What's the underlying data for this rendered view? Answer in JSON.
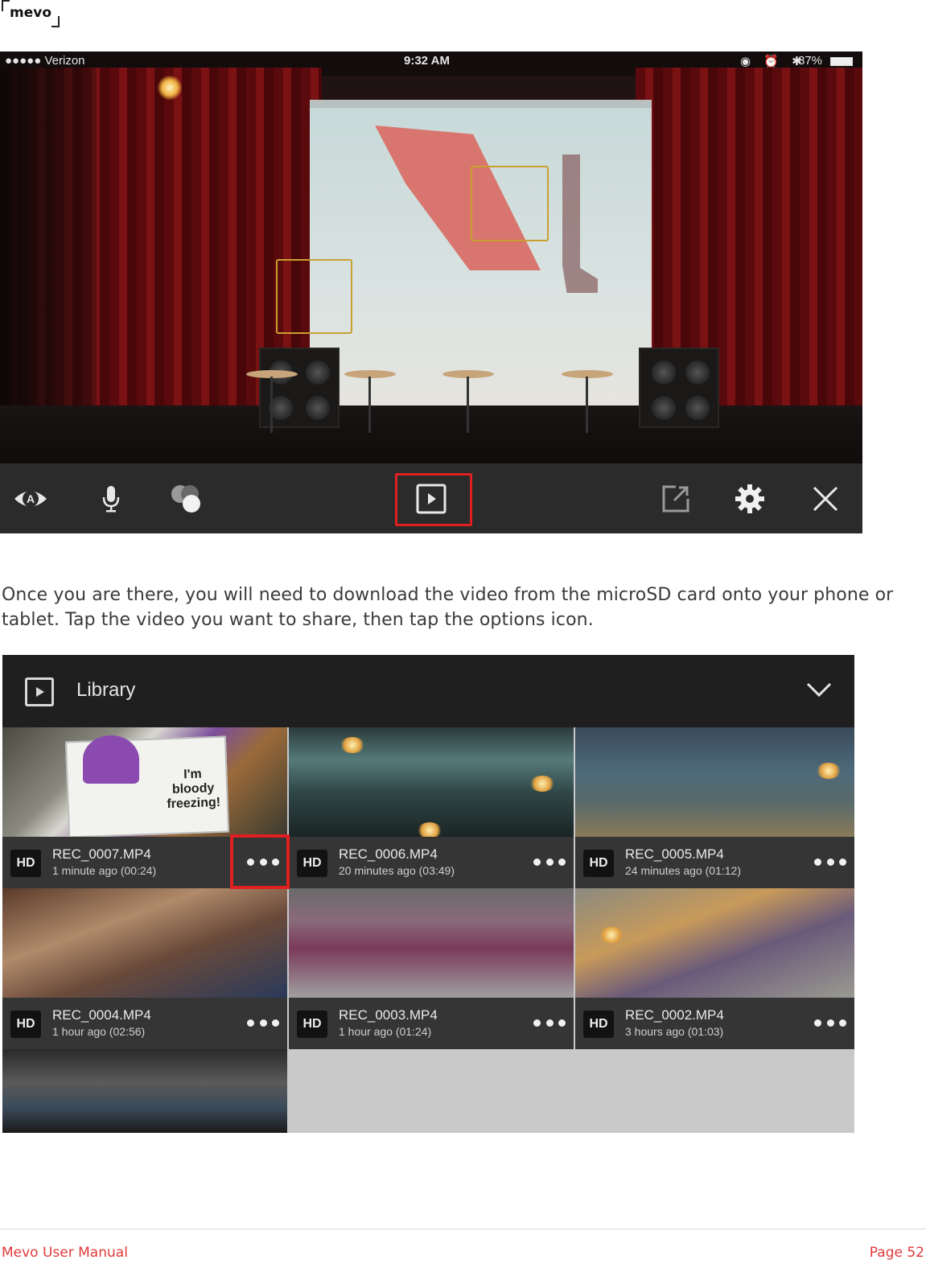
{
  "header": {
    "logo_text": "mevo"
  },
  "camera_view": {
    "status_bar": {
      "carrier": "●●●●● Verizon",
      "time": "9:32 AM",
      "battery": "87%"
    },
    "toolbar": {
      "items": [
        {
          "name": "auto-mode-icon"
        },
        {
          "name": "microphone-icon"
        },
        {
          "name": "color-filters-icon"
        },
        {
          "name": "library-play-icon",
          "highlighted": true
        },
        {
          "name": "share-export-icon"
        },
        {
          "name": "settings-gear-icon"
        },
        {
          "name": "close-icon"
        }
      ]
    }
  },
  "instruction": "Once you are there, you will need to download the video from the microSD card onto your phone or tablet. Tap the video you want to share, then tap the options icon.",
  "library": {
    "title": "Library",
    "videos": [
      {
        "badge": "HD",
        "name": "REC_0007.MP4",
        "info": "1 minute ago (00:24)",
        "highlighted_options": true
      },
      {
        "badge": "HD",
        "name": "REC_0006.MP4",
        "info": "20 minutes ago (03:49)"
      },
      {
        "badge": "HD",
        "name": "REC_0005.MP4",
        "info": "24 minutes ago (01:12)"
      },
      {
        "badge": "HD",
        "name": "REC_0004.MP4",
        "info": "1 hour ago (02:56)"
      },
      {
        "badge": "HD",
        "name": "REC_0003.MP4",
        "info": "1 hour ago (01:24)"
      },
      {
        "badge": "HD",
        "name": "REC_0002.MP4",
        "info": "3 hours ago (01:03)"
      }
    ],
    "sign_text": "I'm bloody freezing!"
  },
  "footer": {
    "left": "Mevo User Manual",
    "right": "Page 52"
  },
  "colors": {
    "accent_red": "#e02020",
    "footer_red": "#e03a3a",
    "focus_box": "#c9a030"
  }
}
